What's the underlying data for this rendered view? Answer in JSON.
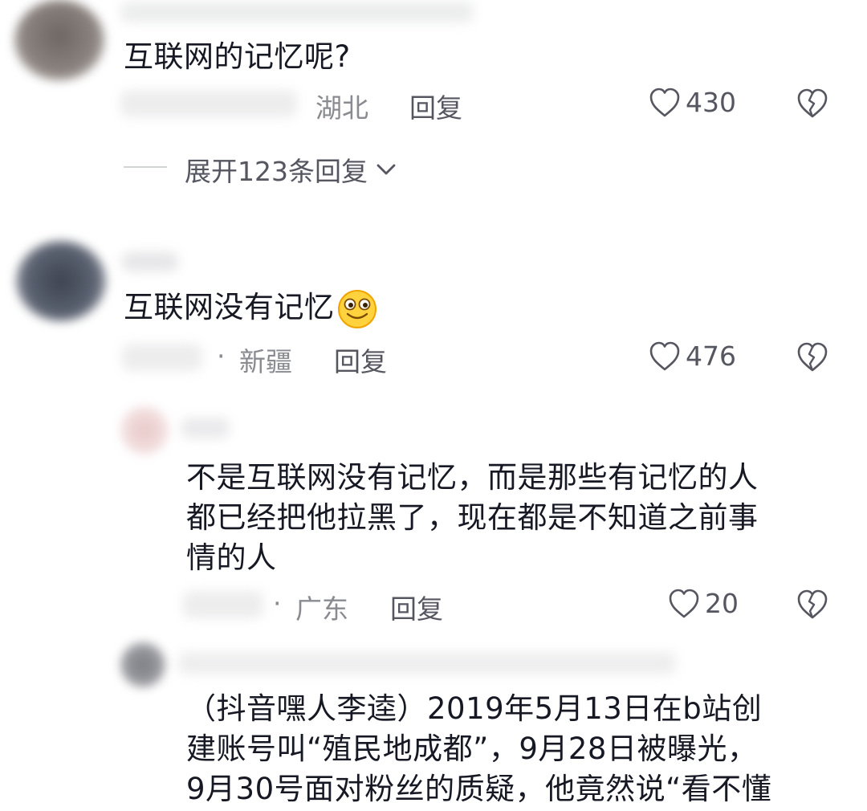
{
  "comments": [
    {
      "text": "互联网的记忆呢?",
      "location": "湖北",
      "reply_label": "回复",
      "likes": "430",
      "expand_label": "展开123条回复"
    },
    {
      "text": "互联网没有记忆",
      "emoji": "smile-emoji",
      "location_prefix": "·",
      "location": "新疆",
      "reply_label": "回复",
      "likes": "476"
    }
  ],
  "replies": [
    {
      "lines": [
        "不是互联网没有记忆，而是那些有记忆的人",
        "都已经把他拉黑了，现在都是不知道之前事",
        "情的人"
      ],
      "location_prefix": "·",
      "location": "广东",
      "reply_label": "回复",
      "likes": "20"
    },
    {
      "lines": [
        "（抖音嘿人李逵）2019年5月13日在b站创",
        "建账号叫“殖民地成都”，9月28日被曝光，",
        "9月30号面对粉丝的质疑，他竟然说“看不懂"
      ]
    }
  ],
  "icons": {
    "like": "heart-outline-icon",
    "dislike": "broken-heart-icon",
    "expand": "chevron-down-icon"
  },
  "colors": {
    "text": "#161823",
    "meta": "#8a8b91",
    "icon": "#555660"
  }
}
